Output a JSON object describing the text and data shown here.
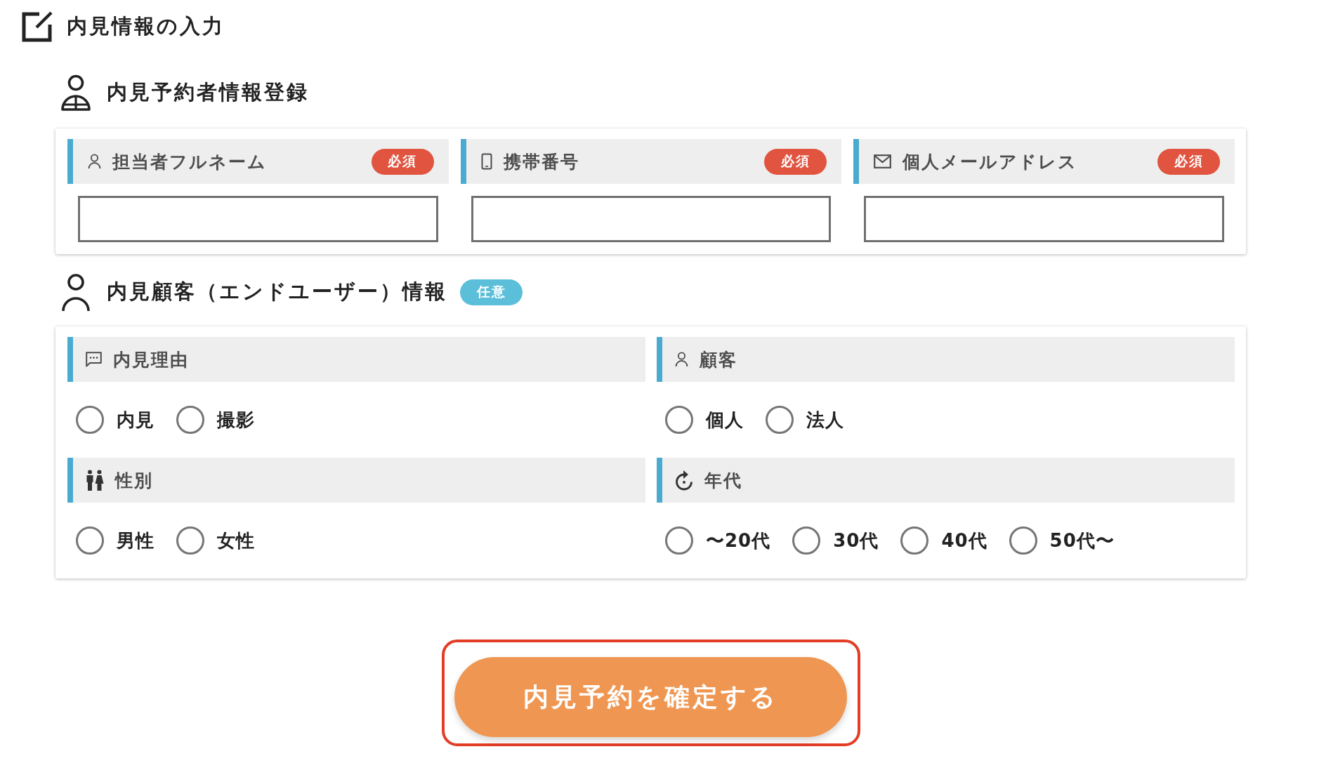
{
  "page": {
    "title": "内見情報の入力"
  },
  "sections": [
    {
      "kind": "text_fields",
      "title": "内見予約者情報登録",
      "fields": [
        {
          "label": "担当者フルネーム",
          "badge": {
            "text": "必須",
            "kind": "required"
          }
        },
        {
          "label": "携帯番号",
          "badge": {
            "text": "必須",
            "kind": "required"
          }
        },
        {
          "label": "個人メールアドレス",
          "badge": {
            "text": "必須",
            "kind": "required"
          }
        }
      ]
    },
    {
      "kind": "choice_groups",
      "title": "内見顧客（エンドユーザー）情報",
      "badge": {
        "text": "任意",
        "kind": "optional"
      },
      "groups": [
        {
          "label": "内見理由",
          "options": [
            {
              "label": "内見",
              "selected": false
            },
            {
              "label": "撮影",
              "selected": false
            }
          ]
        },
        {
          "label": "顧客",
          "options": [
            {
              "label": "個人",
              "selected": false
            },
            {
              "label": "法人",
              "selected": false
            }
          ]
        },
        {
          "label": "性別",
          "options": [
            {
              "label": "男性",
              "selected": false
            },
            {
              "label": "女性",
              "selected": false
            }
          ]
        },
        {
          "label": "年代",
          "options": [
            {
              "label": "〜20代",
              "selected": false
            },
            {
              "label": "30代",
              "selected": false
            },
            {
              "label": "40代",
              "selected": false
            },
            {
              "label": "50代〜",
              "selected": false
            }
          ]
        }
      ]
    }
  ],
  "submit_button": {
    "label": "内見予約を確定する"
  }
}
